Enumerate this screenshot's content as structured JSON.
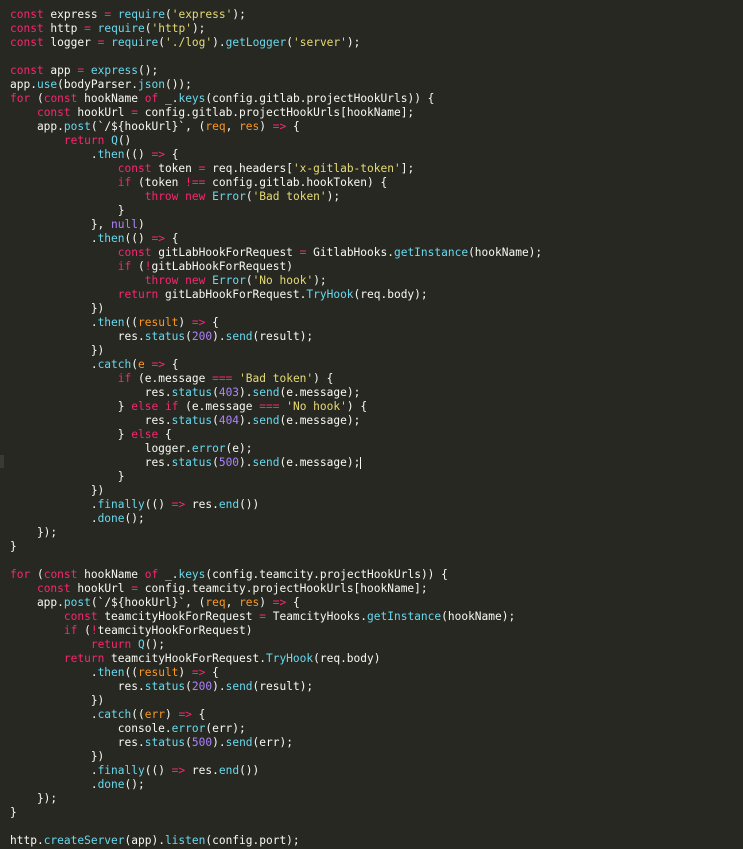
{
  "colors": {
    "background": "#272822",
    "text": "#f8f8f2",
    "keyword": "#f92672",
    "string": "#e6db74",
    "function": "#66d9ef",
    "number": "#ae81ff",
    "parameter": "#fd971f"
  },
  "editor": {
    "lines": [
      [
        [
          "k",
          "const"
        ],
        [
          "t",
          " express "
        ],
        [
          "k",
          "="
        ],
        [
          "t",
          " "
        ],
        [
          "f",
          "require"
        ],
        [
          "t",
          "("
        ],
        [
          "s",
          "'express'"
        ],
        [
          "t",
          ");"
        ]
      ],
      [
        [
          "k",
          "const"
        ],
        [
          "t",
          " http "
        ],
        [
          "k",
          "="
        ],
        [
          "t",
          " "
        ],
        [
          "f",
          "require"
        ],
        [
          "t",
          "("
        ],
        [
          "s",
          "'http'"
        ],
        [
          "t",
          ");"
        ]
      ],
      [
        [
          "k",
          "const"
        ],
        [
          "t",
          " logger "
        ],
        [
          "k",
          "="
        ],
        [
          "t",
          " "
        ],
        [
          "f",
          "require"
        ],
        [
          "t",
          "("
        ],
        [
          "s",
          "'./log'"
        ],
        [
          "t",
          ")."
        ],
        [
          "f",
          "getLogger"
        ],
        [
          "t",
          "("
        ],
        [
          "s",
          "'server'"
        ],
        [
          "t",
          ");"
        ]
      ],
      [],
      [
        [
          "k",
          "const"
        ],
        [
          "t",
          " app "
        ],
        [
          "k",
          "="
        ],
        [
          "t",
          " "
        ],
        [
          "f",
          "express"
        ],
        [
          "t",
          "();"
        ]
      ],
      [
        [
          "t",
          "app."
        ],
        [
          "f",
          "use"
        ],
        [
          "t",
          "(bodyParser."
        ],
        [
          "f",
          "json"
        ],
        [
          "t",
          "());"
        ]
      ],
      [
        [
          "k",
          "for"
        ],
        [
          "t",
          " ("
        ],
        [
          "k",
          "const"
        ],
        [
          "t",
          " hookName "
        ],
        [
          "k",
          "of"
        ],
        [
          "t",
          " _."
        ],
        [
          "f",
          "keys"
        ],
        [
          "t",
          "(config.gitlab.projectHookUrls)) {"
        ]
      ],
      [
        [
          "t",
          "    "
        ],
        [
          "k",
          "const"
        ],
        [
          "t",
          " hookUrl "
        ],
        [
          "k",
          "="
        ],
        [
          "t",
          " config.gitlab.projectHookUrls[hookName];"
        ]
      ],
      [
        [
          "t",
          "    app."
        ],
        [
          "f",
          "post"
        ],
        [
          "t",
          "(`/${hookUrl}`, ("
        ],
        [
          "p",
          "req"
        ],
        [
          "t",
          ", "
        ],
        [
          "p",
          "res"
        ],
        [
          "t",
          ") "
        ],
        [
          "k",
          "=>"
        ],
        [
          "t",
          " {"
        ]
      ],
      [
        [
          "t",
          "        "
        ],
        [
          "k",
          "return"
        ],
        [
          "t",
          " "
        ],
        [
          "f",
          "Q"
        ],
        [
          "t",
          "()"
        ]
      ],
      [
        [
          "t",
          "            ."
        ],
        [
          "f",
          "then"
        ],
        [
          "t",
          "(() "
        ],
        [
          "k",
          "=>"
        ],
        [
          "t",
          " {"
        ]
      ],
      [
        [
          "t",
          "                "
        ],
        [
          "k",
          "const"
        ],
        [
          "t",
          " token "
        ],
        [
          "k",
          "="
        ],
        [
          "t",
          " req.headers["
        ],
        [
          "s",
          "'x-gitlab-token'"
        ],
        [
          "t",
          "];"
        ]
      ],
      [
        [
          "t",
          "                "
        ],
        [
          "k",
          "if"
        ],
        [
          "t",
          " (token "
        ],
        [
          "k",
          "!=="
        ],
        [
          "t",
          " config.gitlab.hookToken) {"
        ]
      ],
      [
        [
          "t",
          "                    "
        ],
        [
          "k",
          "throw"
        ],
        [
          "t",
          " "
        ],
        [
          "k",
          "new"
        ],
        [
          "t",
          " "
        ],
        [
          "f",
          "Error"
        ],
        [
          "t",
          "("
        ],
        [
          "s",
          "'Bad token'"
        ],
        [
          "t",
          ");"
        ]
      ],
      [
        [
          "t",
          "                }"
        ]
      ],
      [
        [
          "t",
          "            }, "
        ],
        [
          "n",
          "null"
        ],
        [
          "t",
          ")"
        ]
      ],
      [
        [
          "t",
          "            ."
        ],
        [
          "f",
          "then"
        ],
        [
          "t",
          "(() "
        ],
        [
          "k",
          "=>"
        ],
        [
          "t",
          " {"
        ]
      ],
      [
        [
          "t",
          "                "
        ],
        [
          "k",
          "const"
        ],
        [
          "t",
          " gitLabHookForRequest "
        ],
        [
          "k",
          "="
        ],
        [
          "t",
          " GitlabHooks."
        ],
        [
          "f",
          "getInstance"
        ],
        [
          "t",
          "(hookName);"
        ]
      ],
      [
        [
          "t",
          "                "
        ],
        [
          "k",
          "if"
        ],
        [
          "t",
          " ("
        ],
        [
          "k",
          "!"
        ],
        [
          "t",
          "gitLabHookForRequest)"
        ]
      ],
      [
        [
          "t",
          "                    "
        ],
        [
          "k",
          "throw"
        ],
        [
          "t",
          " "
        ],
        [
          "k",
          "new"
        ],
        [
          "t",
          " "
        ],
        [
          "f",
          "Error"
        ],
        [
          "t",
          "("
        ],
        [
          "s",
          "'No hook'"
        ],
        [
          "t",
          ");"
        ]
      ],
      [
        [
          "t",
          "                "
        ],
        [
          "k",
          "return"
        ],
        [
          "t",
          " gitLabHookForRequest."
        ],
        [
          "f",
          "TryHook"
        ],
        [
          "t",
          "(req.body);"
        ]
      ],
      [
        [
          "t",
          "            })"
        ]
      ],
      [
        [
          "t",
          "            ."
        ],
        [
          "f",
          "then"
        ],
        [
          "t",
          "(("
        ],
        [
          "p",
          "result"
        ],
        [
          "t",
          ") "
        ],
        [
          "k",
          "=>"
        ],
        [
          "t",
          " {"
        ]
      ],
      [
        [
          "t",
          "                res."
        ],
        [
          "f",
          "status"
        ],
        [
          "t",
          "("
        ],
        [
          "n",
          "200"
        ],
        [
          "t",
          ")."
        ],
        [
          "f",
          "send"
        ],
        [
          "t",
          "(result);"
        ]
      ],
      [
        [
          "t",
          "            })"
        ]
      ],
      [
        [
          "t",
          "            ."
        ],
        [
          "f",
          "catch"
        ],
        [
          "t",
          "("
        ],
        [
          "p",
          "e"
        ],
        [
          "t",
          " "
        ],
        [
          "k",
          "=>"
        ],
        [
          "t",
          " {"
        ]
      ],
      [
        [
          "t",
          "                "
        ],
        [
          "k",
          "if"
        ],
        [
          "t",
          " (e.message "
        ],
        [
          "k",
          "==="
        ],
        [
          "t",
          " "
        ],
        [
          "s",
          "'Bad token'"
        ],
        [
          "t",
          ") {"
        ]
      ],
      [
        [
          "t",
          "                    res."
        ],
        [
          "f",
          "status"
        ],
        [
          "t",
          "("
        ],
        [
          "n",
          "403"
        ],
        [
          "t",
          ")."
        ],
        [
          "f",
          "send"
        ],
        [
          "t",
          "(e.message);"
        ]
      ],
      [
        [
          "t",
          "                } "
        ],
        [
          "k",
          "else"
        ],
        [
          "t",
          " "
        ],
        [
          "k",
          "if"
        ],
        [
          "t",
          " (e.message "
        ],
        [
          "k",
          "==="
        ],
        [
          "t",
          " "
        ],
        [
          "s",
          "'No hook'"
        ],
        [
          "t",
          ") {"
        ]
      ],
      [
        [
          "t",
          "                    res."
        ],
        [
          "f",
          "status"
        ],
        [
          "t",
          "("
        ],
        [
          "n",
          "404"
        ],
        [
          "t",
          ")."
        ],
        [
          "f",
          "send"
        ],
        [
          "t",
          "(e.message);"
        ]
      ],
      [
        [
          "t",
          "                } "
        ],
        [
          "k",
          "else"
        ],
        [
          "t",
          " {"
        ]
      ],
      [
        [
          "t",
          "                    logger."
        ],
        [
          "f",
          "error"
        ],
        [
          "t",
          "(e);"
        ]
      ],
      [
        [
          "t",
          "                    res."
        ],
        [
          "f",
          "status"
        ],
        [
          "t",
          "("
        ],
        [
          "n",
          "500"
        ],
        [
          "t",
          ")."
        ],
        [
          "f",
          "send"
        ],
        [
          "t",
          "(e.message);"
        ]
      ],
      [
        [
          "t",
          "                }"
        ]
      ],
      [
        [
          "t",
          "            })"
        ]
      ],
      [
        [
          "t",
          "            ."
        ],
        [
          "f",
          "finally"
        ],
        [
          "t",
          "(() "
        ],
        [
          "k",
          "=>"
        ],
        [
          "t",
          " res."
        ],
        [
          "f",
          "end"
        ],
        [
          "t",
          "())"
        ]
      ],
      [
        [
          "t",
          "            ."
        ],
        [
          "f",
          "done"
        ],
        [
          "t",
          "();"
        ]
      ],
      [
        [
          "t",
          "    });"
        ]
      ],
      [
        [
          "t",
          "}"
        ]
      ],
      [],
      [
        [
          "k",
          "for"
        ],
        [
          "t",
          " ("
        ],
        [
          "k",
          "const"
        ],
        [
          "t",
          " hookName "
        ],
        [
          "k",
          "of"
        ],
        [
          "t",
          " _."
        ],
        [
          "f",
          "keys"
        ],
        [
          "t",
          "(config.teamcity.projectHookUrls)) {"
        ]
      ],
      [
        [
          "t",
          "    "
        ],
        [
          "k",
          "const"
        ],
        [
          "t",
          " hookUrl "
        ],
        [
          "k",
          "="
        ],
        [
          "t",
          " config.teamcity.projectHookUrls[hookName];"
        ]
      ],
      [
        [
          "t",
          "    app."
        ],
        [
          "f",
          "post"
        ],
        [
          "t",
          "(`/${hookUrl}`, ("
        ],
        [
          "p",
          "req"
        ],
        [
          "t",
          ", "
        ],
        [
          "p",
          "res"
        ],
        [
          "t",
          ") "
        ],
        [
          "k",
          "=>"
        ],
        [
          "t",
          " {"
        ]
      ],
      [
        [
          "t",
          "        "
        ],
        [
          "k",
          "const"
        ],
        [
          "t",
          " teamcityHookForRequest "
        ],
        [
          "k",
          "="
        ],
        [
          "t",
          " TeamcityHooks."
        ],
        [
          "f",
          "getInstance"
        ],
        [
          "t",
          "(hookName);"
        ]
      ],
      [
        [
          "t",
          "        "
        ],
        [
          "k",
          "if"
        ],
        [
          "t",
          " ("
        ],
        [
          "k",
          "!"
        ],
        [
          "t",
          "teamcityHookForRequest)"
        ]
      ],
      [
        [
          "t",
          "            "
        ],
        [
          "k",
          "return"
        ],
        [
          "t",
          " "
        ],
        [
          "f",
          "Q"
        ],
        [
          "t",
          "();"
        ]
      ],
      [
        [
          "t",
          "        "
        ],
        [
          "k",
          "return"
        ],
        [
          "t",
          " teamcityHookForRequest."
        ],
        [
          "f",
          "TryHook"
        ],
        [
          "t",
          "(req.body)"
        ]
      ],
      [
        [
          "t",
          "            ."
        ],
        [
          "f",
          "then"
        ],
        [
          "t",
          "(("
        ],
        [
          "p",
          "result"
        ],
        [
          "t",
          ") "
        ],
        [
          "k",
          "=>"
        ],
        [
          "t",
          " {"
        ]
      ],
      [
        [
          "t",
          "                res."
        ],
        [
          "f",
          "status"
        ],
        [
          "t",
          "("
        ],
        [
          "n",
          "200"
        ],
        [
          "t",
          ")."
        ],
        [
          "f",
          "send"
        ],
        [
          "t",
          "(result);"
        ]
      ],
      [
        [
          "t",
          "            })"
        ]
      ],
      [
        [
          "t",
          "            ."
        ],
        [
          "f",
          "catch"
        ],
        [
          "t",
          "(("
        ],
        [
          "p",
          "err"
        ],
        [
          "t",
          ") "
        ],
        [
          "k",
          "=>"
        ],
        [
          "t",
          " {"
        ]
      ],
      [
        [
          "t",
          "                console."
        ],
        [
          "f",
          "error"
        ],
        [
          "t",
          "(err);"
        ]
      ],
      [
        [
          "t",
          "                res."
        ],
        [
          "f",
          "status"
        ],
        [
          "t",
          "("
        ],
        [
          "n",
          "500"
        ],
        [
          "t",
          ")."
        ],
        [
          "f",
          "send"
        ],
        [
          "t",
          "(err);"
        ]
      ],
      [
        [
          "t",
          "            })"
        ]
      ],
      [
        [
          "t",
          "            ."
        ],
        [
          "f",
          "finally"
        ],
        [
          "t",
          "(() "
        ],
        [
          "k",
          "=>"
        ],
        [
          "t",
          " res."
        ],
        [
          "f",
          "end"
        ],
        [
          "t",
          "())"
        ]
      ],
      [
        [
          "t",
          "            ."
        ],
        [
          "f",
          "done"
        ],
        [
          "t",
          "();"
        ]
      ],
      [
        [
          "t",
          "    });"
        ]
      ],
      [
        [
          "t",
          "}"
        ]
      ],
      [],
      [
        [
          "t",
          "http."
        ],
        [
          "f",
          "createServer"
        ],
        [
          "t",
          "(app)."
        ],
        [
          "f",
          "listen"
        ],
        [
          "t",
          "(config.port);"
        ]
      ]
    ]
  }
}
